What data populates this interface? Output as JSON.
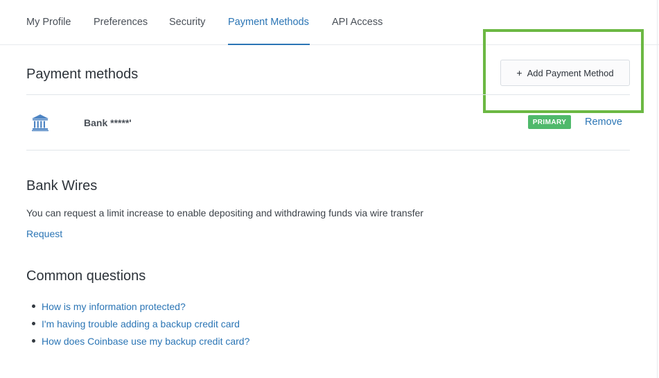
{
  "tabs": [
    {
      "label": "My Profile",
      "active": false
    },
    {
      "label": "Preferences",
      "active": false
    },
    {
      "label": "Security",
      "active": false
    },
    {
      "label": "Payment Methods",
      "active": true
    },
    {
      "label": "API Access",
      "active": false
    }
  ],
  "payment_methods": {
    "title": "Payment methods",
    "add_button_icon": "plus-icon",
    "add_button_label": "Add Payment Method",
    "items": [
      {
        "icon": "bank-icon",
        "name": "Bank *****'",
        "badge": "PRIMARY",
        "remove_label": "Remove"
      }
    ]
  },
  "bank_wires": {
    "title": "Bank Wires",
    "description": "You can request a limit increase to enable depositing and withdrawing funds via wire transfer",
    "request_label": "Request"
  },
  "common_questions": {
    "title": "Common questions",
    "items": [
      "How is my information protected?",
      "I'm having trouble adding a backup credit card",
      "How does Coinbase use my backup credit card?"
    ]
  },
  "colors": {
    "link": "#2b75b5",
    "badge": "#4fb96b",
    "highlight": "#6cb843"
  }
}
